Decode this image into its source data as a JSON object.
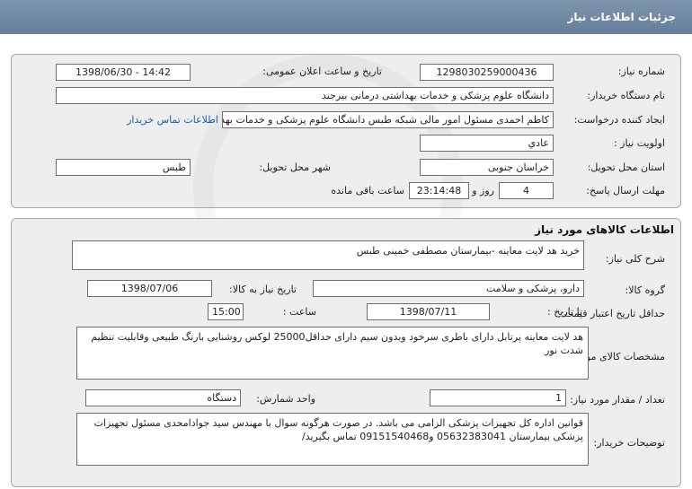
{
  "header": {
    "title": "جزئیات اطلاعات نیاز"
  },
  "need_info": {
    "need_number_label": "شماره نیاز:",
    "need_number": "1298030259000436",
    "announce_label": "تاریخ و ساعت اعلان عمومی:",
    "announce_value": "1398/06/30 - 14:42",
    "buyer_label": "نام دستگاه خریدار:",
    "buyer_value": "دانشگاه علوم پزشکی و خدمات بهداشتی درمانی بیرجند",
    "creator_label": "ایجاد کننده درخواست:",
    "creator_value": "کاظم احمدی مسئول امور مالی شبکه طبس دانشگاه علوم پزشکی و خدمات بهداشتی درمانی بیرجند",
    "contact_link": "اطلاعات تماس خریدار",
    "priority_label": "اولویت نیاز :",
    "priority_value": "عادي",
    "province_label": "استان محل تحویل:",
    "province_value": "خراسان جنوبی",
    "city_label": "شهر محل تحویل:",
    "city_value": "طبس",
    "deadline_label": "مهلت ارسال پاسخ:",
    "deadline_days": "4",
    "days_and": "روز و",
    "deadline_time": "23:14:48",
    "remaining": "ساعت باقی مانده"
  },
  "goods": {
    "title": "اطلاعات کالاهای مورد نیاز",
    "summary_label": "شرح کلی نیاز:",
    "summary_value": "خرید هد لایت معاینه -بیمارستان مصطفی خمینی طبس",
    "group_label": "گروه کالا:",
    "group_value": "دارو، پزشکی و سلامت",
    "need_date_label": "تاریخ نیاز به کالا:",
    "need_date_value": "1398/07/06",
    "validity_label": "حداقل تاریخ اعتبار قیمت:",
    "until_label": "تا تاریخ :",
    "validity_date": "1398/07/11",
    "hour_label": "ساعت :",
    "validity_time": "15:00",
    "spec_label": "مشخصات کالای مورد نیاز:",
    "spec_value": "هد لایت معاینه پرتابل دارای باطری سرخود وبدون سیم دارای حداقل25000 لوکس روشنایی بارنگ طبیعی وقابلیت تنظیم شدت نور",
    "qty_label": "تعداد / مقدار مورد نیاز:",
    "qty_value": "1",
    "unit_label": "واحد شمارش:",
    "unit_value": "دستگاه",
    "notes_label": "توضیحات خریدار:",
    "notes_value": "قوانین اداره کل تجهیزات پزشکی الزامی می باشد.  در صورت هرگونه سوال با مهندس سید جوادامحدی مسئول تجهیزات پزشکی بیمارستان 05632383041 و09151540468 تماس بگیرید/"
  }
}
